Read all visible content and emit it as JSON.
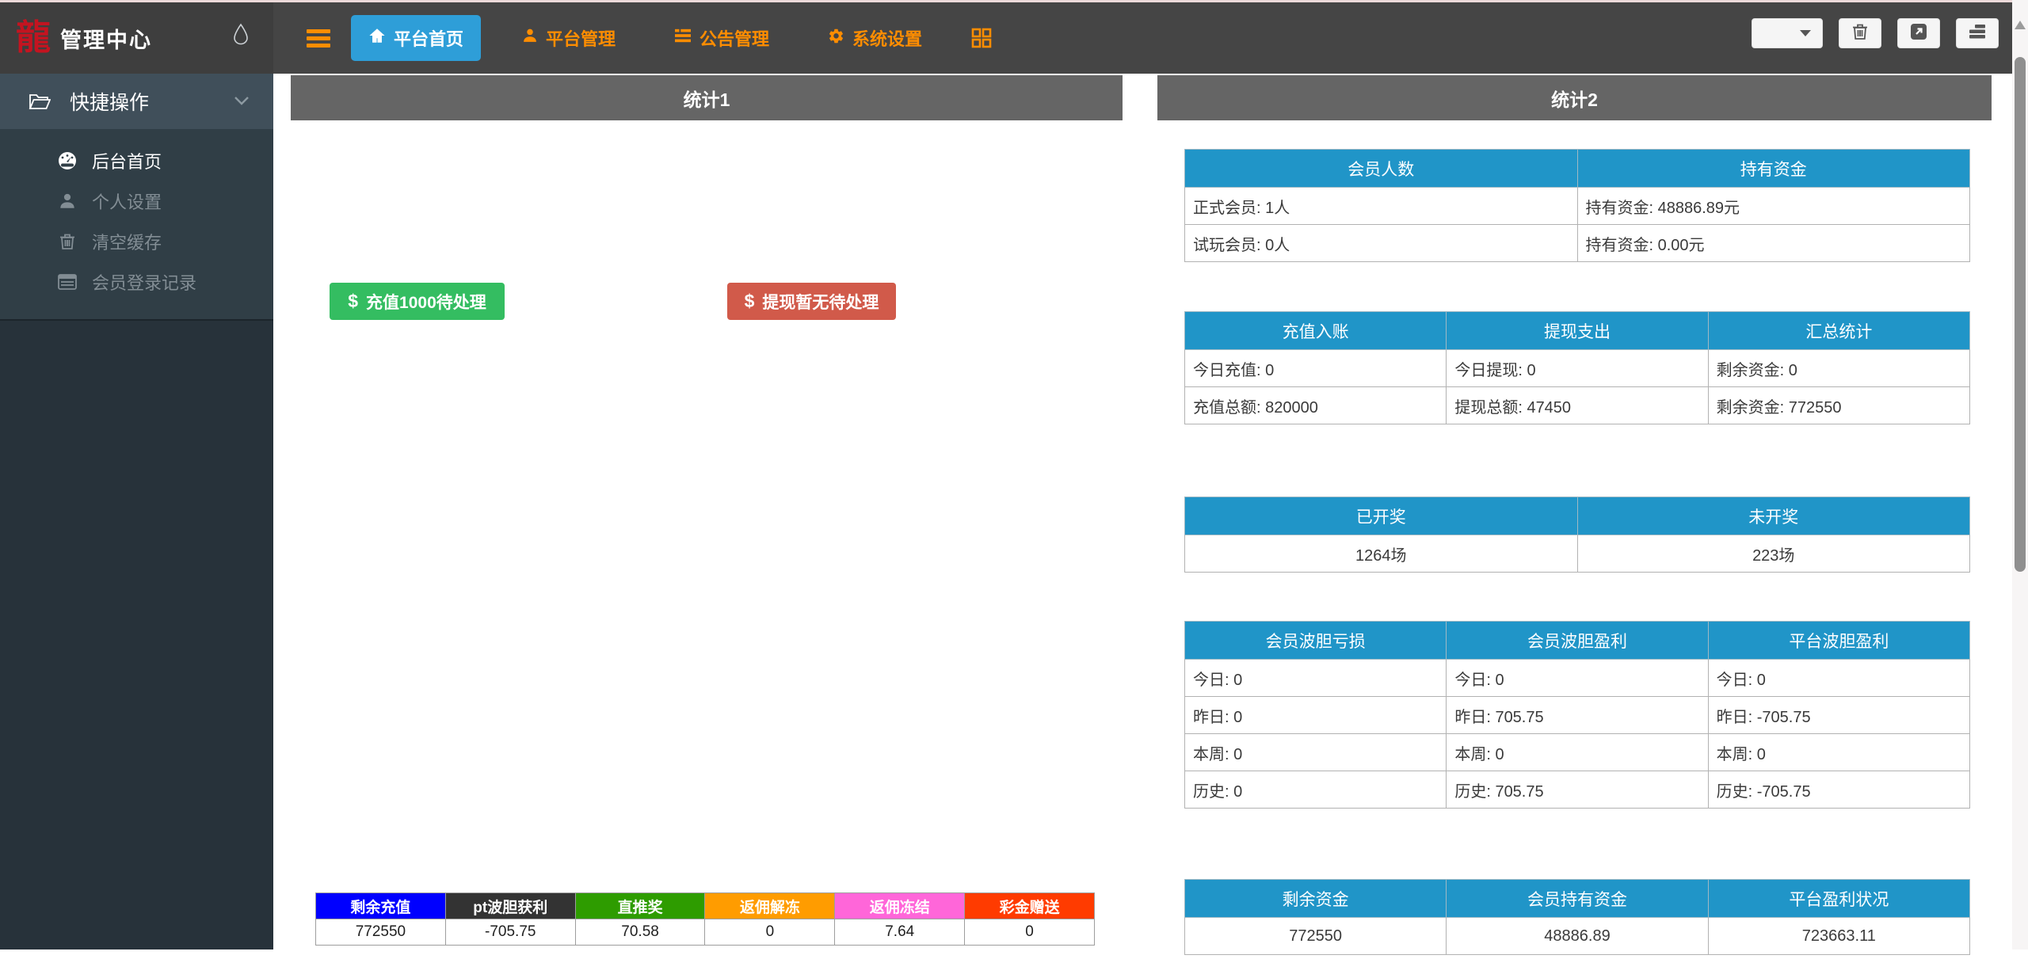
{
  "header": {
    "brand": "管理中心",
    "logo_glyph": "龍",
    "tabs": [
      {
        "label": "平台首页",
        "active": true
      },
      {
        "label": "平台管理",
        "active": false
      },
      {
        "label": "公告管理",
        "active": false
      },
      {
        "label": "系统设置",
        "active": false
      }
    ]
  },
  "sidebar": {
    "group_label": "快捷操作",
    "items": [
      {
        "label": "后台首页",
        "active": true
      },
      {
        "label": "个人设置",
        "active": false
      },
      {
        "label": "清空缓存",
        "active": false
      },
      {
        "label": "会员登录记录",
        "active": false
      }
    ]
  },
  "panel1": {
    "title": "统计1",
    "deposit_button": {
      "icon": "$",
      "label": "充值1000待处理"
    },
    "withdraw_button": {
      "icon": "$",
      "label": "提现暂无待处理"
    },
    "summary_table": {
      "headers": [
        {
          "label": "剩余充值",
          "color": "#0000ff"
        },
        {
          "label": "pt波胆获利",
          "color": "#333333"
        },
        {
          "label": "直推奖",
          "color": "#2e9c00"
        },
        {
          "label": "返佣解冻",
          "color": "#ff9c00"
        },
        {
          "label": "返佣冻结",
          "color": "#ff66d9"
        },
        {
          "label": "彩金赠送",
          "color": "#ff3b00"
        }
      ],
      "values": [
        "772550",
        "-705.75",
        "70.58",
        "0",
        "7.64",
        "0"
      ]
    }
  },
  "panel2": {
    "title": "统计2",
    "tables": [
      {
        "headers": [
          "会员人数",
          "持有资金"
        ],
        "rows": [
          [
            "正式会员: 1人",
            "持有资金: 48886.89元"
          ],
          [
            "试玩会员: 0人",
            "持有资金: 0.00元"
          ]
        ]
      },
      {
        "headers": [
          "充值入账",
          "提现支出",
          "汇总统计"
        ],
        "rows": [
          [
            "今日充值: 0",
            "今日提现: 0",
            "剩余资金: 0"
          ],
          [
            "充值总额: 820000",
            "提现总额: 47450",
            "剩余资金: 772550"
          ]
        ]
      },
      {
        "headers": [
          "已开奖",
          "未开奖"
        ],
        "rows": [
          [
            "1264场",
            "223场"
          ]
        ]
      },
      {
        "headers": [
          "会员波胆亏损",
          "会员波胆盈利",
          "平台波胆盈利"
        ],
        "rows": [
          [
            "今日: 0",
            "今日: 0",
            "今日: 0"
          ],
          [
            "昨日: 0",
            "昨日: 705.75",
            "昨日: -705.75"
          ],
          [
            "本周: 0",
            "本周: 0",
            "本周: 0"
          ],
          [
            "历史: 0",
            "历史: 705.75",
            "历史: -705.75"
          ]
        ]
      },
      {
        "headers": [
          "剩余资金",
          "会员持有资金",
          "平台盈利状况"
        ],
        "rows": [
          [
            "772550",
            "48886.89",
            "723663.11"
          ]
        ]
      }
    ]
  },
  "colors": {
    "accent_orange": "#ff8d00",
    "active_tab_blue": "#2e9ed8",
    "table_header_blue": "#2095c8",
    "panel_header_gray": "#656565",
    "button_green": "#34bd61",
    "button_red": "#d15a4a",
    "logo_red": "#c41420"
  }
}
